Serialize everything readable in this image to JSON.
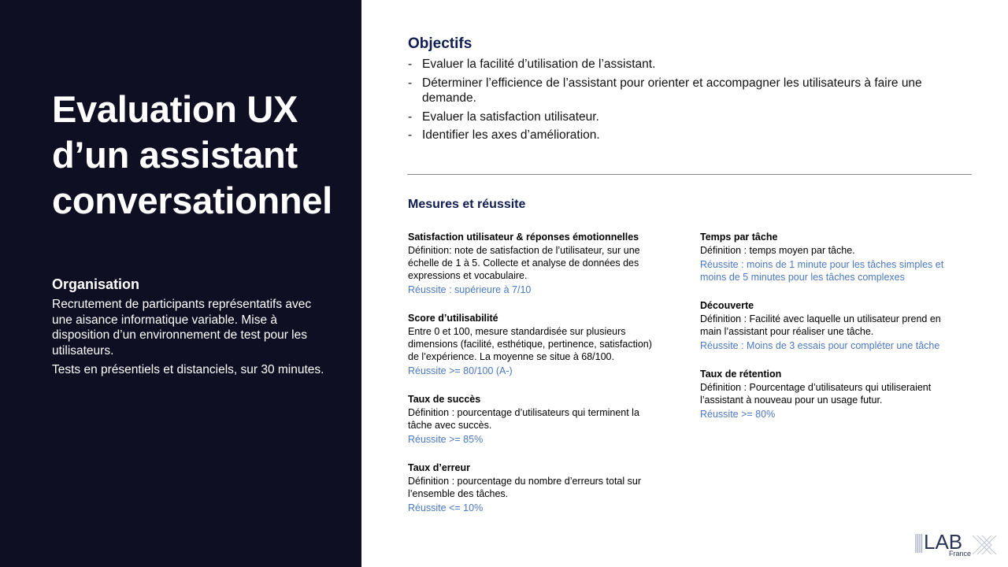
{
  "left": {
    "title_lines": [
      "Evaluation UX",
      "d’un assistant",
      "conversationnel"
    ],
    "organisation": {
      "heading": "Organisation",
      "paragraphs": [
        "Recrutement de participants représentatifs avec une aisance informatique variable. Mise à disposition d’un environnement de test pour les utilisateurs.",
        "Tests en présentiels et distanciels, sur 30 minutes."
      ]
    }
  },
  "objectives": {
    "heading": "Objectifs",
    "items": [
      "Evaluer la facilité d’utilisation de l’assistant.",
      "Déterminer l’efficience de l’assistant pour orienter et accompagner les utilisateurs à faire une demande.",
      "Evaluer la satisfaction utilisateur.",
      "Identifier les axes d’amélioration."
    ]
  },
  "measures": {
    "heading": "Mesures et réussite",
    "left": [
      {
        "title": "Satisfaction utilisateur & réponses émotionnelles",
        "definition": "Définition: note de satisfaction de l’utilisateur, sur une échelle de 1 à 5. Collecte et analyse de données des expressions et vocabulaire.",
        "success": "Réussite : supérieure à 7/10"
      },
      {
        "title": "Score d’utilisabilité",
        "definition": "Entre 0 et 100, mesure standardisée sur plusieurs dimensions (facilité, esthétique, pertinence, satisfaction) de l’expérience. La moyenne se situe à 68/100.",
        "success": "Réussite >= 80/100 (A-)"
      },
      {
        "title": "Taux de succès",
        "definition": "Définition : pourcentage d’utilisateurs qui terminent la tâche avec succès.",
        "success": "Réussite >= 85%"
      },
      {
        "title": "Taux d’erreur",
        "definition": "Définition : pourcentage du nombre d’erreurs total sur l’ensemble des tâches.",
        "success": "Réussite <= 10%"
      }
    ],
    "right": [
      {
        "title": "Temps par tâche",
        "definition": "Définition : temps moyen par tâche.",
        "success": "Réussite : moins de 1 minute pour les tâches simples et moins de 5 minutes pour les tâches complexes"
      },
      {
        "title": "Découverte",
        "definition": "Définition : Facilité avec laquelle un utilisateur prend en main l’assistant pour réaliser une tâche.",
        "success": "Réussite : Moins de 3 essais pour compléter une tâche"
      },
      {
        "title": "Taux de rétention",
        "definition": "Définition : Pourcentage d’utilisateurs qui utiliseraient l’assistant à nouveau pour un usage futur.",
        "success": "Réussite >= 80%"
      }
    ]
  },
  "logo": {
    "text": "LAB",
    "subtext": "France"
  },
  "colors": {
    "panel_bg": "#0f0f24",
    "heading_navy": "#0f1d52",
    "success_blue": "#4a78c2"
  }
}
